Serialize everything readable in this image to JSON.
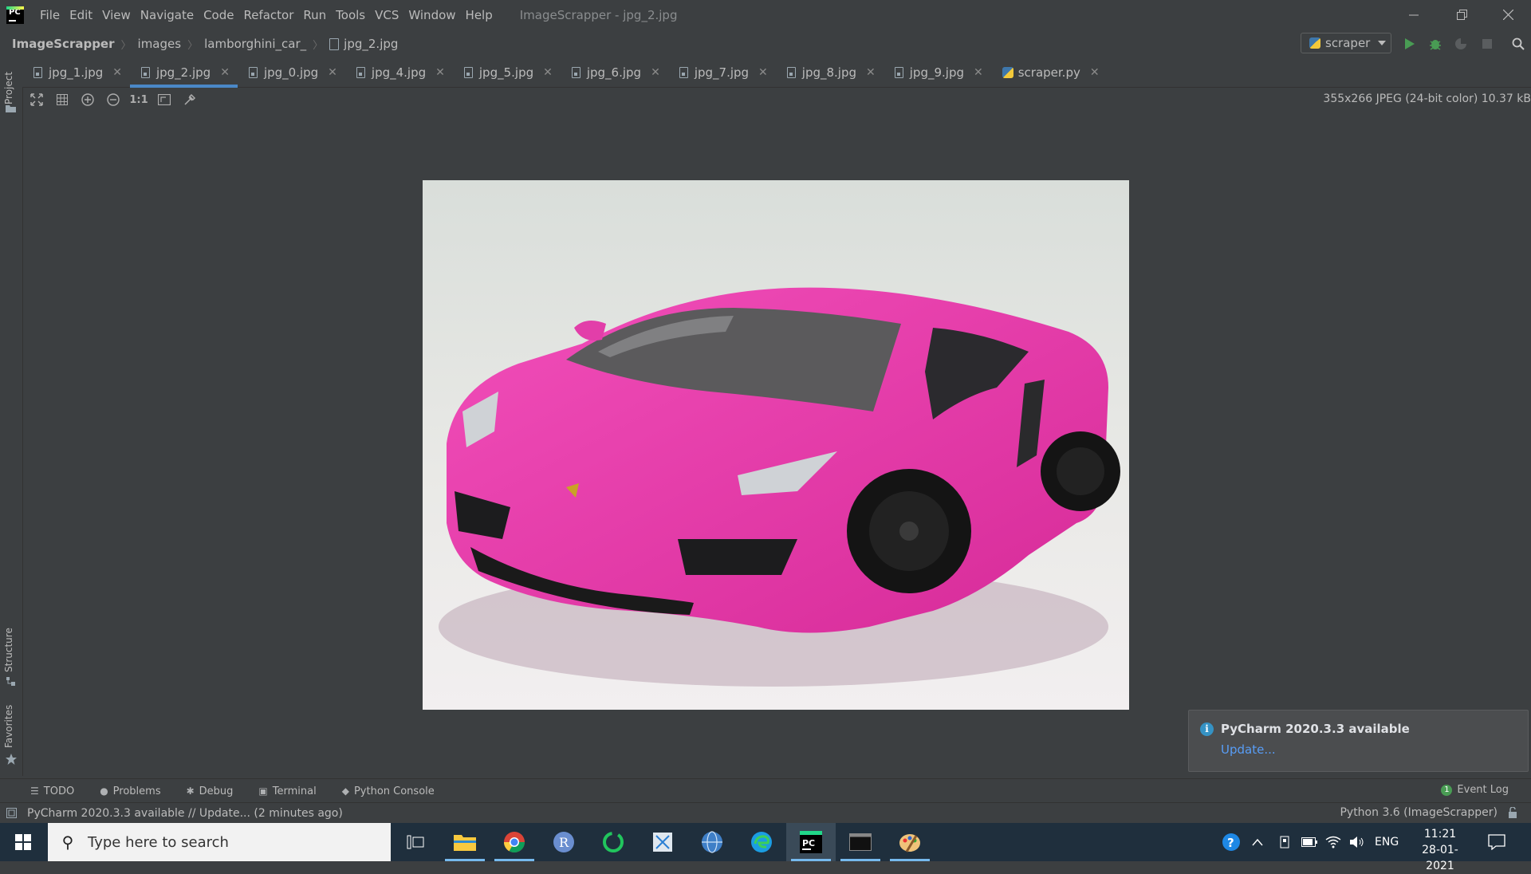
{
  "window": {
    "title": "ImageScrapper - jpg_2.jpg",
    "menu": [
      "File",
      "Edit",
      "View",
      "Navigate",
      "Code",
      "Refactor",
      "Run",
      "Tools",
      "VCS",
      "Window",
      "Help"
    ]
  },
  "breadcrumb": {
    "project": "ImageScrapper",
    "folder1": "images",
    "folder2": "lamborghini_car_",
    "file": "jpg_2.jpg"
  },
  "run_config": {
    "label": "scraper"
  },
  "tabs": [
    {
      "label": "jpg_1.jpg"
    },
    {
      "label": "jpg_2.jpg"
    },
    {
      "label": "jpg_0.jpg"
    },
    {
      "label": "jpg_4.jpg"
    },
    {
      "label": "jpg_5.jpg"
    },
    {
      "label": "jpg_6.jpg"
    },
    {
      "label": "jpg_7.jpg"
    },
    {
      "label": "jpg_8.jpg"
    },
    {
      "label": "jpg_9.jpg"
    },
    {
      "label": "scraper.py"
    }
  ],
  "side_tabs": {
    "project": "Project",
    "structure": "Structure",
    "favorites": "Favorites"
  },
  "image_toolbar": {
    "actual_size": "1:1"
  },
  "image_info": "355x266 JPEG (24-bit color) 10.37 kB",
  "notification": {
    "title": "PyCharm 2020.3.3 available",
    "link": "Update..."
  },
  "tool_windows": {
    "todo": "TODO",
    "problems": "Problems",
    "debug": "Debug",
    "terminal": "Terminal",
    "python_console": "Python Console",
    "event_log": "Event Log",
    "event_count": "1"
  },
  "status": {
    "message": "PyCharm 2020.3.3 available // Update... (2 minutes ago)",
    "interpreter": "Python 3.6 (ImageScrapper)"
  },
  "taskbar": {
    "search_placeholder": "Type here to search",
    "language": "ENG",
    "time": "11:21",
    "date": "28-01-2021"
  },
  "colors": {
    "ide_bg": "#3c3f41",
    "accent": "#4a88c7",
    "car_pink": "#ee3aae",
    "taskbar": "#1f2f3d"
  }
}
